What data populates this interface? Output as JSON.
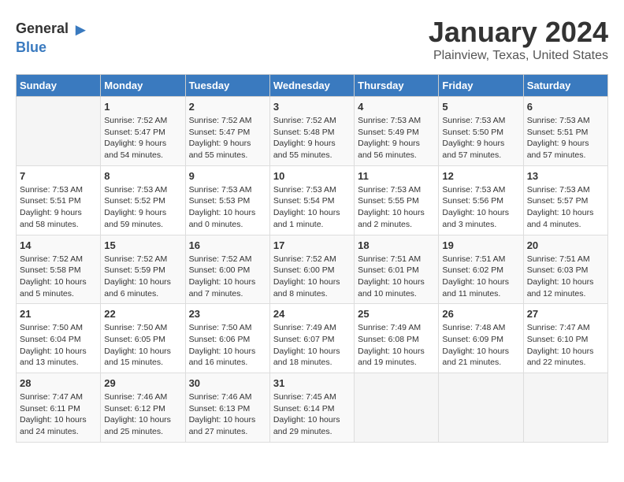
{
  "logo": {
    "general": "General",
    "blue": "Blue"
  },
  "header": {
    "title": "January 2024",
    "subtitle": "Plainview, Texas, United States"
  },
  "days_of_week": [
    "Sunday",
    "Monday",
    "Tuesday",
    "Wednesday",
    "Thursday",
    "Friday",
    "Saturday"
  ],
  "weeks": [
    [
      {
        "num": "",
        "empty": true
      },
      {
        "num": "1",
        "sunrise": "Sunrise: 7:52 AM",
        "sunset": "Sunset: 5:47 PM",
        "daylight": "Daylight: 9 hours and 54 minutes."
      },
      {
        "num": "2",
        "sunrise": "Sunrise: 7:52 AM",
        "sunset": "Sunset: 5:47 PM",
        "daylight": "Daylight: 9 hours and 55 minutes."
      },
      {
        "num": "3",
        "sunrise": "Sunrise: 7:52 AM",
        "sunset": "Sunset: 5:48 PM",
        "daylight": "Daylight: 9 hours and 55 minutes."
      },
      {
        "num": "4",
        "sunrise": "Sunrise: 7:53 AM",
        "sunset": "Sunset: 5:49 PM",
        "daylight": "Daylight: 9 hours and 56 minutes."
      },
      {
        "num": "5",
        "sunrise": "Sunrise: 7:53 AM",
        "sunset": "Sunset: 5:50 PM",
        "daylight": "Daylight: 9 hours and 57 minutes."
      },
      {
        "num": "6",
        "sunrise": "Sunrise: 7:53 AM",
        "sunset": "Sunset: 5:51 PM",
        "daylight": "Daylight: 9 hours and 57 minutes."
      }
    ],
    [
      {
        "num": "7",
        "sunrise": "Sunrise: 7:53 AM",
        "sunset": "Sunset: 5:51 PM",
        "daylight": "Daylight: 9 hours and 58 minutes."
      },
      {
        "num": "8",
        "sunrise": "Sunrise: 7:53 AM",
        "sunset": "Sunset: 5:52 PM",
        "daylight": "Daylight: 9 hours and 59 minutes."
      },
      {
        "num": "9",
        "sunrise": "Sunrise: 7:53 AM",
        "sunset": "Sunset: 5:53 PM",
        "daylight": "Daylight: 10 hours and 0 minutes."
      },
      {
        "num": "10",
        "sunrise": "Sunrise: 7:53 AM",
        "sunset": "Sunset: 5:54 PM",
        "daylight": "Daylight: 10 hours and 1 minute."
      },
      {
        "num": "11",
        "sunrise": "Sunrise: 7:53 AM",
        "sunset": "Sunset: 5:55 PM",
        "daylight": "Daylight: 10 hours and 2 minutes."
      },
      {
        "num": "12",
        "sunrise": "Sunrise: 7:53 AM",
        "sunset": "Sunset: 5:56 PM",
        "daylight": "Daylight: 10 hours and 3 minutes."
      },
      {
        "num": "13",
        "sunrise": "Sunrise: 7:53 AM",
        "sunset": "Sunset: 5:57 PM",
        "daylight": "Daylight: 10 hours and 4 minutes."
      }
    ],
    [
      {
        "num": "14",
        "sunrise": "Sunrise: 7:52 AM",
        "sunset": "Sunset: 5:58 PM",
        "daylight": "Daylight: 10 hours and 5 minutes."
      },
      {
        "num": "15",
        "sunrise": "Sunrise: 7:52 AM",
        "sunset": "Sunset: 5:59 PM",
        "daylight": "Daylight: 10 hours and 6 minutes."
      },
      {
        "num": "16",
        "sunrise": "Sunrise: 7:52 AM",
        "sunset": "Sunset: 6:00 PM",
        "daylight": "Daylight: 10 hours and 7 minutes."
      },
      {
        "num": "17",
        "sunrise": "Sunrise: 7:52 AM",
        "sunset": "Sunset: 6:00 PM",
        "daylight": "Daylight: 10 hours and 8 minutes."
      },
      {
        "num": "18",
        "sunrise": "Sunrise: 7:51 AM",
        "sunset": "Sunset: 6:01 PM",
        "daylight": "Daylight: 10 hours and 10 minutes."
      },
      {
        "num": "19",
        "sunrise": "Sunrise: 7:51 AM",
        "sunset": "Sunset: 6:02 PM",
        "daylight": "Daylight: 10 hours and 11 minutes."
      },
      {
        "num": "20",
        "sunrise": "Sunrise: 7:51 AM",
        "sunset": "Sunset: 6:03 PM",
        "daylight": "Daylight: 10 hours and 12 minutes."
      }
    ],
    [
      {
        "num": "21",
        "sunrise": "Sunrise: 7:50 AM",
        "sunset": "Sunset: 6:04 PM",
        "daylight": "Daylight: 10 hours and 13 minutes."
      },
      {
        "num": "22",
        "sunrise": "Sunrise: 7:50 AM",
        "sunset": "Sunset: 6:05 PM",
        "daylight": "Daylight: 10 hours and 15 minutes."
      },
      {
        "num": "23",
        "sunrise": "Sunrise: 7:50 AM",
        "sunset": "Sunset: 6:06 PM",
        "daylight": "Daylight: 10 hours and 16 minutes."
      },
      {
        "num": "24",
        "sunrise": "Sunrise: 7:49 AM",
        "sunset": "Sunset: 6:07 PM",
        "daylight": "Daylight: 10 hours and 18 minutes."
      },
      {
        "num": "25",
        "sunrise": "Sunrise: 7:49 AM",
        "sunset": "Sunset: 6:08 PM",
        "daylight": "Daylight: 10 hours and 19 minutes."
      },
      {
        "num": "26",
        "sunrise": "Sunrise: 7:48 AM",
        "sunset": "Sunset: 6:09 PM",
        "daylight": "Daylight: 10 hours and 21 minutes."
      },
      {
        "num": "27",
        "sunrise": "Sunrise: 7:47 AM",
        "sunset": "Sunset: 6:10 PM",
        "daylight": "Daylight: 10 hours and 22 minutes."
      }
    ],
    [
      {
        "num": "28",
        "sunrise": "Sunrise: 7:47 AM",
        "sunset": "Sunset: 6:11 PM",
        "daylight": "Daylight: 10 hours and 24 minutes."
      },
      {
        "num": "29",
        "sunrise": "Sunrise: 7:46 AM",
        "sunset": "Sunset: 6:12 PM",
        "daylight": "Daylight: 10 hours and 25 minutes."
      },
      {
        "num": "30",
        "sunrise": "Sunrise: 7:46 AM",
        "sunset": "Sunset: 6:13 PM",
        "daylight": "Daylight: 10 hours and 27 minutes."
      },
      {
        "num": "31",
        "sunrise": "Sunrise: 7:45 AM",
        "sunset": "Sunset: 6:14 PM",
        "daylight": "Daylight: 10 hours and 29 minutes."
      },
      {
        "num": "",
        "empty": true
      },
      {
        "num": "",
        "empty": true
      },
      {
        "num": "",
        "empty": true
      }
    ]
  ]
}
